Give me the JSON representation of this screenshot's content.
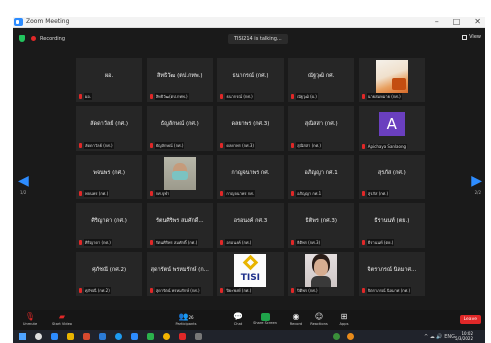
{
  "window": {
    "title": "Zoom Meeting",
    "controls": [
      "–",
      "□",
      "✕"
    ]
  },
  "top_bar": {
    "recording": "Recording",
    "talking": "TISI214 is talking...",
    "view": "View"
  },
  "tiles": [
    {
      "name": "ผอ.",
      "label": "ผอ."
    },
    {
      "name": "สิทธิวัฒ (ตป.กทพ.)",
      "label": "สิทธิวัฒ(ตป.กทพ.)"
    },
    {
      "name": "ธนากรณ์ (กศ.)",
      "label": "ธนากรณ์ (กศ.)"
    },
    {
      "name": "ณัฐวุฒิ กศ.",
      "label": "ณัฐวุฒิ (ผ.)"
    },
    {
      "name": "",
      "label": "นายสมหมาย (กศ.)",
      "video": "orange"
    },
    {
      "name": "ลัดดาวัลย์ (กศ.)",
      "label": "ลัดดาวัลย์ (กศ.)"
    },
    {
      "name": "ธัญลักษณ์ (กศ.)",
      "label": "ธัญลักษณ์ (กศ.)"
    },
    {
      "name": "ดลยาพร (กศ.3)",
      "label": "ดลยาพร (กศ.3)"
    },
    {
      "name": "สุณิสสา (กศ.)",
      "label": "สุณิสสา (กศ.)"
    },
    {
      "name": "",
      "label": "Apichaya Sanlaong",
      "avatar": "A"
    },
    {
      "name": "พจนพร (กศ.)",
      "label": "พจนพร (กศ.)"
    },
    {
      "name": "",
      "label": "กศ.จุฬา",
      "video": "mask"
    },
    {
      "name": "กาญจนาพร กศ.",
      "label": "กาญจนาพร กศ."
    },
    {
      "name": "อภิญญา กศ.1",
      "label": "อภิญญา กศ.1"
    },
    {
      "name": "สุรภัส (กศ.)",
      "label": "สุรภัส (กศ.)"
    },
    {
      "name": "ศิริญาดา (กศ.)",
      "label": "ศิริญาดา (กศ.)"
    },
    {
      "name": "รัตนศิริพร สมศักดิ์...",
      "label": "รัตนศิริพร สมศักดิ์ (กศ.)"
    },
    {
      "name": "อรอนงค์ กศ.3",
      "label": "อรอนงค์ (กศ.)"
    },
    {
      "name": "ธิติพร (กศ.3)",
      "label": "ธิติพร (กศ.3)"
    },
    {
      "name": "ธีรานนท์ (ตย.)",
      "label": "ธีรานนท์ (ตย.)"
    },
    {
      "name": "ศุภัชณี (กศ.2)",
      "label": "ศุภัชณี (กศ.2)"
    },
    {
      "name": "สุดารัตน์ พรหมรักษ์ (ก...",
      "label": "สุดารัตน์ พรหมรักษ์ (กศ.)"
    },
    {
      "name": "",
      "label": "ปิยะพงษ์ (กศ.)",
      "video": "tisi",
      "logo_text": "TISI"
    },
    {
      "name": "",
      "label": "ปิติพร (กศ.)",
      "video": "person"
    },
    {
      "name": "จิตราภรณ์ นิลมาศ...",
      "label": "จิตราภรณ์ นิลมาศ (กศ.)"
    }
  ],
  "pager": {
    "left_page": "1/2",
    "right_page": "2/2"
  },
  "toolbar": {
    "unmute": "Unmute",
    "start_video": "Start Video",
    "participants": "Participants",
    "participant_count": "26",
    "chat": "Chat",
    "share_screen": "Share Screen",
    "record": "Record",
    "reactions": "Reactions",
    "apps": "Apps",
    "end": "Leave"
  },
  "taskbar": {
    "time": "10:02",
    "date": "5/3/2022",
    "tray": "^ ☁ 🔊 ENG"
  }
}
